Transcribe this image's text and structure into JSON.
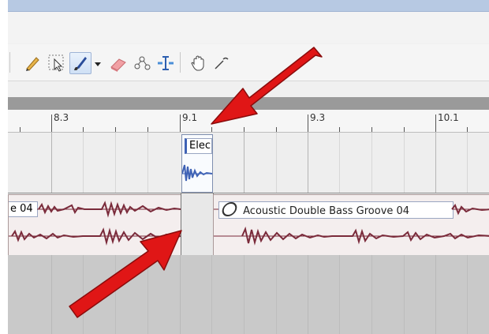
{
  "toolbar": {
    "tools": [
      {
        "name": "pencil-icon"
      },
      {
        "name": "select-arrow-icon"
      },
      {
        "name": "brush-icon",
        "selected": true
      },
      {
        "name": "dropdown-arrow-icon"
      },
      {
        "name": "eraser-icon"
      },
      {
        "name": "node-icon"
      },
      {
        "name": "split-icon"
      },
      {
        "name": "hand-icon"
      },
      {
        "name": "zoom-icon"
      }
    ]
  },
  "ruler": {
    "labels": [
      "8.3",
      "9.1",
      "9.3",
      "10.1"
    ]
  },
  "tracks": {
    "top_clip_label": "Elec",
    "left_clip_label": "e 04",
    "right_clip_label": "Acoustic Double Bass Groove 04"
  },
  "colors": {
    "waveform_blue": "#3f62b5",
    "waveform_red": "#7a2a3a",
    "arrow_red": "#e01616"
  }
}
